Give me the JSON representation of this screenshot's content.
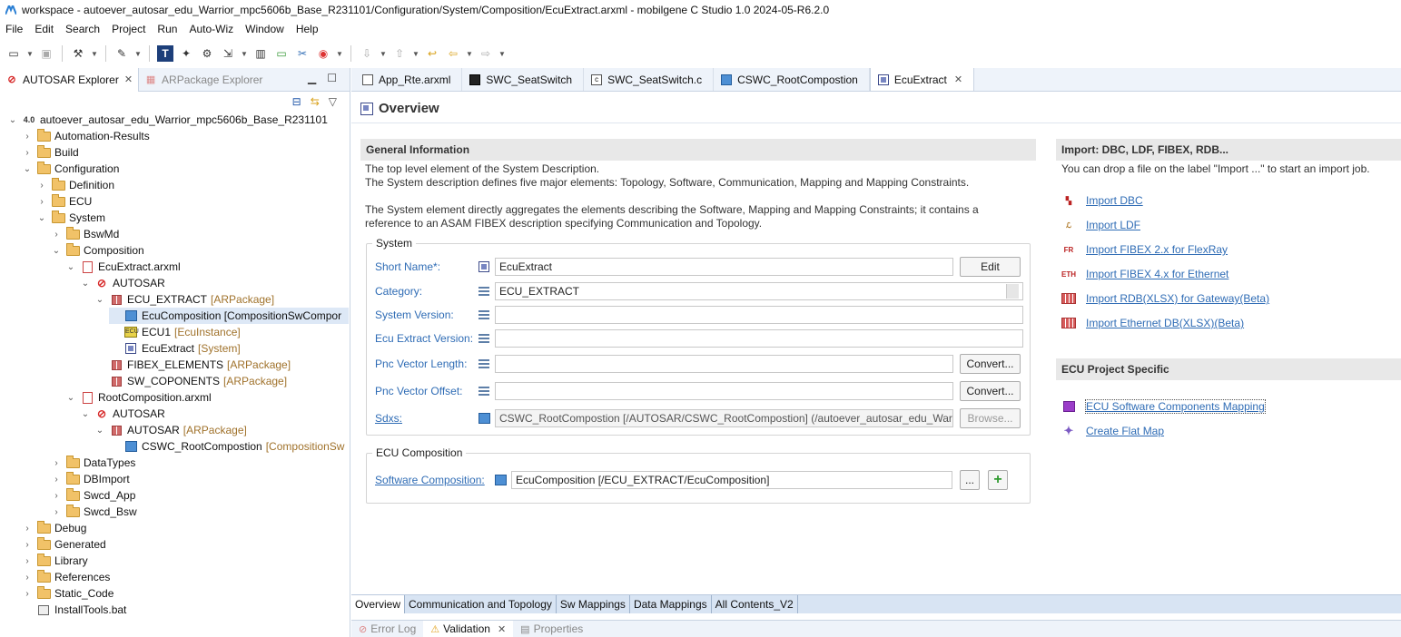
{
  "window": {
    "title": "workspace - autoever_autosar_edu_Warrior_mpc5606b_Base_R231101/Configuration/System/Composition/EcuExtract.arxml - mobilgene C Studio 1.0 2024-05-R6.2.0"
  },
  "menu": [
    "File",
    "Edit",
    "Search",
    "Project",
    "Run",
    "Auto-Wiz",
    "Window",
    "Help"
  ],
  "explorer": {
    "tabs": [
      {
        "label": "AUTOSAR Explorer",
        "icon": "autosar-icon"
      },
      {
        "label": "ARPackage Explorer",
        "icon": "arpackage-icon"
      }
    ],
    "tree": [
      {
        "depth": 0,
        "twisty": "down",
        "icon": "project",
        "label": "autoever_autosar_edu_Warrior_mpc5606b_Base_R231101",
        "tag": ""
      },
      {
        "depth": 1,
        "twisty": "right",
        "icon": "folder",
        "label": "Automation-Results",
        "tag": ""
      },
      {
        "depth": 1,
        "twisty": "right",
        "icon": "folder",
        "label": "Build",
        "tag": ""
      },
      {
        "depth": 1,
        "twisty": "down",
        "icon": "folder",
        "label": "Configuration",
        "tag": ""
      },
      {
        "depth": 2,
        "twisty": "right",
        "icon": "folder",
        "label": "Definition",
        "tag": ""
      },
      {
        "depth": 2,
        "twisty": "right",
        "icon": "folder",
        "label": "ECU",
        "tag": ""
      },
      {
        "depth": 2,
        "twisty": "down",
        "icon": "folder",
        "label": "System",
        "tag": ""
      },
      {
        "depth": 3,
        "twisty": "right",
        "icon": "folder",
        "label": "BswMd",
        "tag": ""
      },
      {
        "depth": 3,
        "twisty": "down",
        "icon": "folder",
        "label": "Composition",
        "tag": ""
      },
      {
        "depth": 4,
        "twisty": "down",
        "icon": "doc",
        "label": "EcuExtract.arxml",
        "tag": ""
      },
      {
        "depth": 5,
        "twisty": "down",
        "icon": "autosar",
        "label": "AUTOSAR",
        "tag": ""
      },
      {
        "depth": 6,
        "twisty": "down",
        "icon": "pkg",
        "label": "ECU_EXTRACT",
        "tag": "[ARPackage]"
      },
      {
        "depth": 7,
        "twisty": "",
        "icon": "comp",
        "label": "EcuComposition [CompositionSwCompor",
        "tag": "",
        "selected": true
      },
      {
        "depth": 7,
        "twisty": "",
        "icon": "ecu",
        "label": "ECU1",
        "tag": "[EcuInstance]"
      },
      {
        "depth": 7,
        "twisty": "",
        "icon": "sys",
        "label": "EcuExtract",
        "tag": "[System]"
      },
      {
        "depth": 6,
        "twisty": "",
        "icon": "pkg",
        "label": "FIBEX_ELEMENTS",
        "tag": "[ARPackage]"
      },
      {
        "depth": 6,
        "twisty": "",
        "icon": "pkg",
        "label": "SW_COPONENTS",
        "tag": "[ARPackage]"
      },
      {
        "depth": 4,
        "twisty": "down",
        "icon": "doc",
        "label": "RootComposition.arxml",
        "tag": ""
      },
      {
        "depth": 5,
        "twisty": "down",
        "icon": "autosar",
        "label": "AUTOSAR",
        "tag": ""
      },
      {
        "depth": 6,
        "twisty": "down",
        "icon": "pkg",
        "label": "AUTOSAR",
        "tag": "[ARPackage]"
      },
      {
        "depth": 7,
        "twisty": "",
        "icon": "comp",
        "label": "CSWC_RootCompostion",
        "tag": "[CompositionSw"
      },
      {
        "depth": 3,
        "twisty": "right",
        "icon": "folder",
        "label": "DataTypes",
        "tag": ""
      },
      {
        "depth": 3,
        "twisty": "right",
        "icon": "folder",
        "label": "DBImport",
        "tag": ""
      },
      {
        "depth": 3,
        "twisty": "right",
        "icon": "folder",
        "label": "Swcd_App",
        "tag": ""
      },
      {
        "depth": 3,
        "twisty": "right",
        "icon": "folder",
        "label": "Swcd_Bsw",
        "tag": ""
      },
      {
        "depth": 1,
        "twisty": "right",
        "icon": "folder",
        "label": "Debug",
        "tag": ""
      },
      {
        "depth": 1,
        "twisty": "right",
        "icon": "folder",
        "label": "Generated",
        "tag": ""
      },
      {
        "depth": 1,
        "twisty": "right",
        "icon": "folder",
        "label": "Library",
        "tag": ""
      },
      {
        "depth": 1,
        "twisty": "right",
        "icon": "folder",
        "label": "References",
        "tag": ""
      },
      {
        "depth": 1,
        "twisty": "right",
        "icon": "folder",
        "label": "Static_Code",
        "tag": ""
      },
      {
        "depth": 1,
        "twisty": "",
        "icon": "bat",
        "label": "InstallTools.bat",
        "tag": ""
      }
    ]
  },
  "editor_tabs": [
    {
      "label": "App_Rte.arxml",
      "icon": "file"
    },
    {
      "label": "SWC_SeatSwitch",
      "icon": "sw"
    },
    {
      "label": "SWC_SeatSwitch.c",
      "icon": "c"
    },
    {
      "label": "CSWC_RootCompostion",
      "icon": "comp"
    },
    {
      "label": "EcuExtract",
      "icon": "sys",
      "active": true
    }
  ],
  "overview": {
    "title": "Overview",
    "general": {
      "header": "General Information",
      "desc1": "The top level element of the System Description.",
      "desc2": "The System description defines five major elements: Topology, Software, Communication, Mapping and Mapping Constraints.",
      "desc3": "The System element directly aggregates the elements describing the Software, Mapping and Mapping Constraints; it contains a",
      "desc4": "reference to an ASAM FIBEX description specifying Communication and Topology."
    },
    "system": {
      "group": "System",
      "short_name_label": "Short Name*:",
      "short_name": "EcuExtract",
      "edit": "Edit",
      "category_label": "Category:",
      "category": "ECU_EXTRACT",
      "system_version_label": "System Version:",
      "ecu_extract_version_label": "Ecu Extract Version:",
      "pnc_length_label": "Pnc Vector Length:",
      "pnc_offset_label": "Pnc Vector Offset:",
      "convert": "Convert...",
      "sdxs_label": "Sdxs:",
      "sdxs": "CSWC_RootCompostion [/AUTOSAR/CSWC_RootCompostion] (/autoever_autosar_edu_Warric",
      "browse": "Browse..."
    },
    "ecu_composition": {
      "group": "ECU Composition",
      "sw_comp_label": "Software Composition:",
      "sw_comp": "EcuComposition [/ECU_EXTRACT/EcuComposition]",
      "ellipsis": "..."
    },
    "import": {
      "header": "Import: DBC, LDF, FIBEX, RDB...",
      "desc": "You can drop a file on the label \"Import ...\" to start an import job.",
      "links": [
        {
          "label": "Import DBC",
          "icon": "dbc-icon"
        },
        {
          "label": "Import LDF",
          "icon": "ldf-icon"
        },
        {
          "label": "Import FIBEX 2.x for FlexRay",
          "icon": "fr-icon"
        },
        {
          "label": "Import FIBEX 4.x for Ethernet",
          "icon": "eth-icon"
        },
        {
          "label": "Import RDB(XLSX) for Gateway(Beta)",
          "icon": "grid-icon"
        },
        {
          "label": "Import Ethernet DB(XLSX)(Beta)",
          "icon": "grid-icon"
        }
      ]
    },
    "ecu_project": {
      "header": "ECU Project Specific",
      "links": [
        {
          "label": "ECU Software Components Mapping",
          "icon": "mapping-icon"
        },
        {
          "label": "Create Flat Map",
          "icon": "sparkle-icon"
        }
      ]
    },
    "bottom_tabs": [
      "Overview",
      "Communication and Topology",
      "Sw Mappings",
      "Data Mappings",
      "All Contents_V2"
    ]
  },
  "bottom_panel": {
    "tabs": [
      {
        "label": "Error Log",
        "icon": "error-log-icon"
      },
      {
        "label": "Validation",
        "icon": "validation-icon",
        "active": true
      },
      {
        "label": "Properties",
        "icon": "properties-icon"
      }
    ]
  }
}
